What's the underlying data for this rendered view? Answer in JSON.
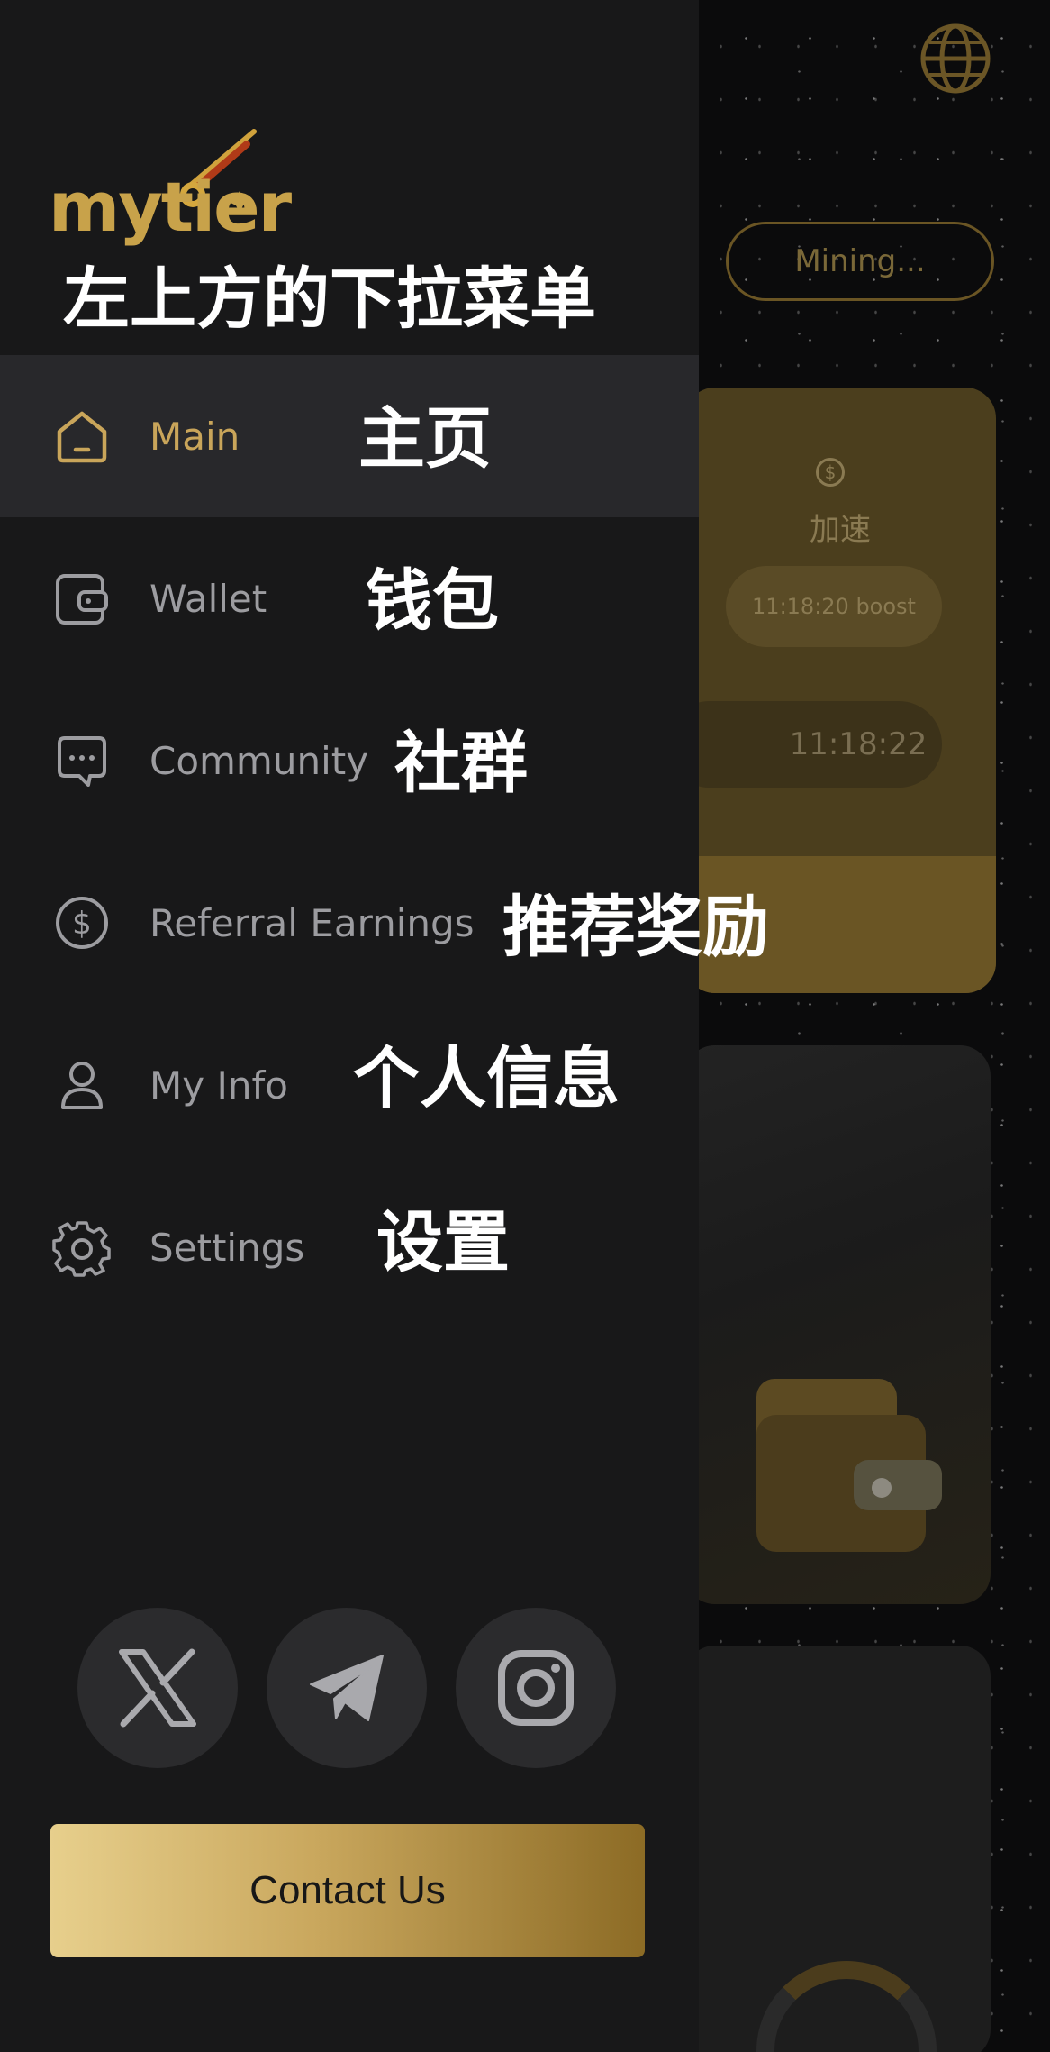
{
  "background": {
    "mining_label": "Mining...",
    "boost_label": "加速",
    "boost_timer": "11:18:20 boost",
    "countdown": "11:18:22",
    "coin_symbol": "$"
  },
  "drawer": {
    "logo_text": "mytier",
    "annotation": "左上方的下拉菜单",
    "menu": [
      {
        "label": "Main",
        "annotation": "主页",
        "icon": "home-icon",
        "active": true
      },
      {
        "label": "Wallet",
        "annotation": "钱包",
        "icon": "wallet-icon",
        "active": false
      },
      {
        "label": "Community",
        "annotation": "社群",
        "icon": "chat-icon",
        "active": false
      },
      {
        "label": "Referral Earnings",
        "annotation": "推荐奖励",
        "icon": "dollar-circle-icon",
        "active": false
      },
      {
        "label": "My Info",
        "annotation": "个人信息",
        "icon": "user-icon",
        "active": false
      },
      {
        "label": "Settings",
        "annotation": "设置",
        "icon": "gear-icon",
        "active": false
      }
    ],
    "social": [
      {
        "icon": "x-icon"
      },
      {
        "icon": "telegram-icon"
      },
      {
        "icon": "instagram-icon"
      }
    ],
    "contact_label": "Contact Us"
  },
  "colors": {
    "accent": "#c9a55a",
    "drawer_bg": "#181819",
    "active_bg": "#28282b",
    "text_muted": "#9c9ca0"
  }
}
